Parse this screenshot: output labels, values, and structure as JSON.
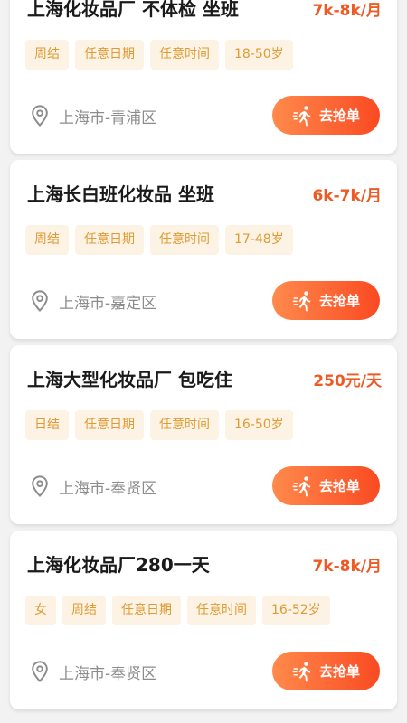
{
  "jobs": [
    {
      "title": "上海化妆品厂 不体检 坐班",
      "salary": "7k-8k/月",
      "tags": [
        "周结",
        "任意日期",
        "任意时间",
        "18-50岁"
      ],
      "location": "上海市-青浦区",
      "button": "去抢单"
    },
    {
      "title": "上海长白班化妆品 坐班",
      "salary": "6k-7k/月",
      "tags": [
        "周结",
        "任意日期",
        "任意时间",
        "17-48岁"
      ],
      "location": "上海市-嘉定区",
      "button": "去抢单"
    },
    {
      "title": "上海大型化妆品厂 包吃住",
      "salary": "250元/天",
      "tags": [
        "日结",
        "任意日期",
        "任意时间",
        "16-50岁"
      ],
      "location": "上海市-奉贤区",
      "button": "去抢单"
    },
    {
      "title": "上海化妆品厂280一天",
      "salary": "7k-8k/月",
      "tags": [
        "女",
        "周结",
        "任意日期",
        "任意时间",
        "16-52岁"
      ],
      "location": "上海市-奉贤区",
      "button": "去抢单"
    }
  ],
  "colors": {
    "salary": "#ee5a24",
    "tag_bg": "#fdf3e5",
    "tag_text": "#e09a33",
    "button_gradient_start": "#ff8a4c",
    "button_gradient_end": "#fa4a22"
  },
  "icons": {
    "location": "location-pin-icon",
    "button": "running-person-icon"
  }
}
